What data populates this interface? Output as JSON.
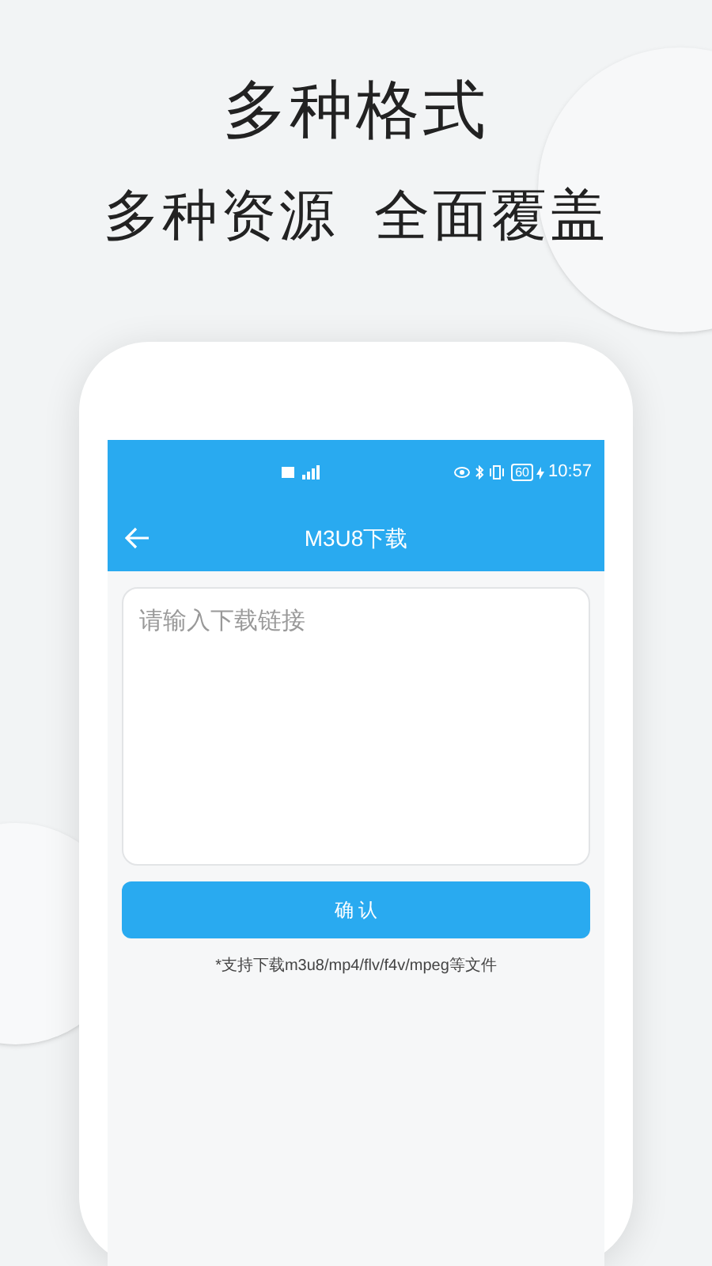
{
  "headline": "多种格式",
  "subheadline": "多种资源  全面覆盖",
  "phone": {
    "status_bar": {
      "battery": "60",
      "time": "10:57"
    },
    "app_bar": {
      "title": "M3U8下载"
    },
    "link_input": {
      "placeholder": "请输入下载链接"
    },
    "confirm_button": "确 认",
    "hint": "*支持下载m3u8/mp4/flv/f4v/mpeg等文件"
  }
}
